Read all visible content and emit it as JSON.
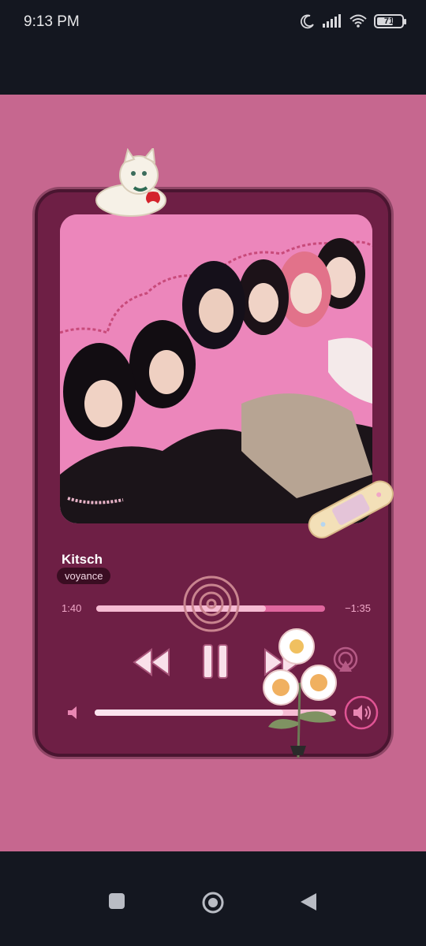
{
  "status_bar": {
    "time": "9:13 PM",
    "battery_level": "71",
    "battery_percent": 71,
    "icons": [
      "moon-icon",
      "signal-icon",
      "wifi-icon",
      "battery-icon"
    ]
  },
  "player": {
    "song_title": "Kitsch",
    "artist": "voyance",
    "elapsed": "1:40",
    "remaining": "−1:35",
    "progress_fraction": 0.74,
    "volume_fraction": 0.78,
    "controls": [
      "rewind-icon",
      "pause-icon",
      "forward-icon",
      "airplay-icon"
    ]
  },
  "colors": {
    "wallpaper": "#c6678f",
    "card": "#6e1f45",
    "accent": "#f6bcd3",
    "album_bg": "#ec86bb"
  },
  "nav_bar": {
    "icons": [
      "recents-square-icon",
      "home-circle-icon",
      "back-triangle-icon"
    ]
  }
}
